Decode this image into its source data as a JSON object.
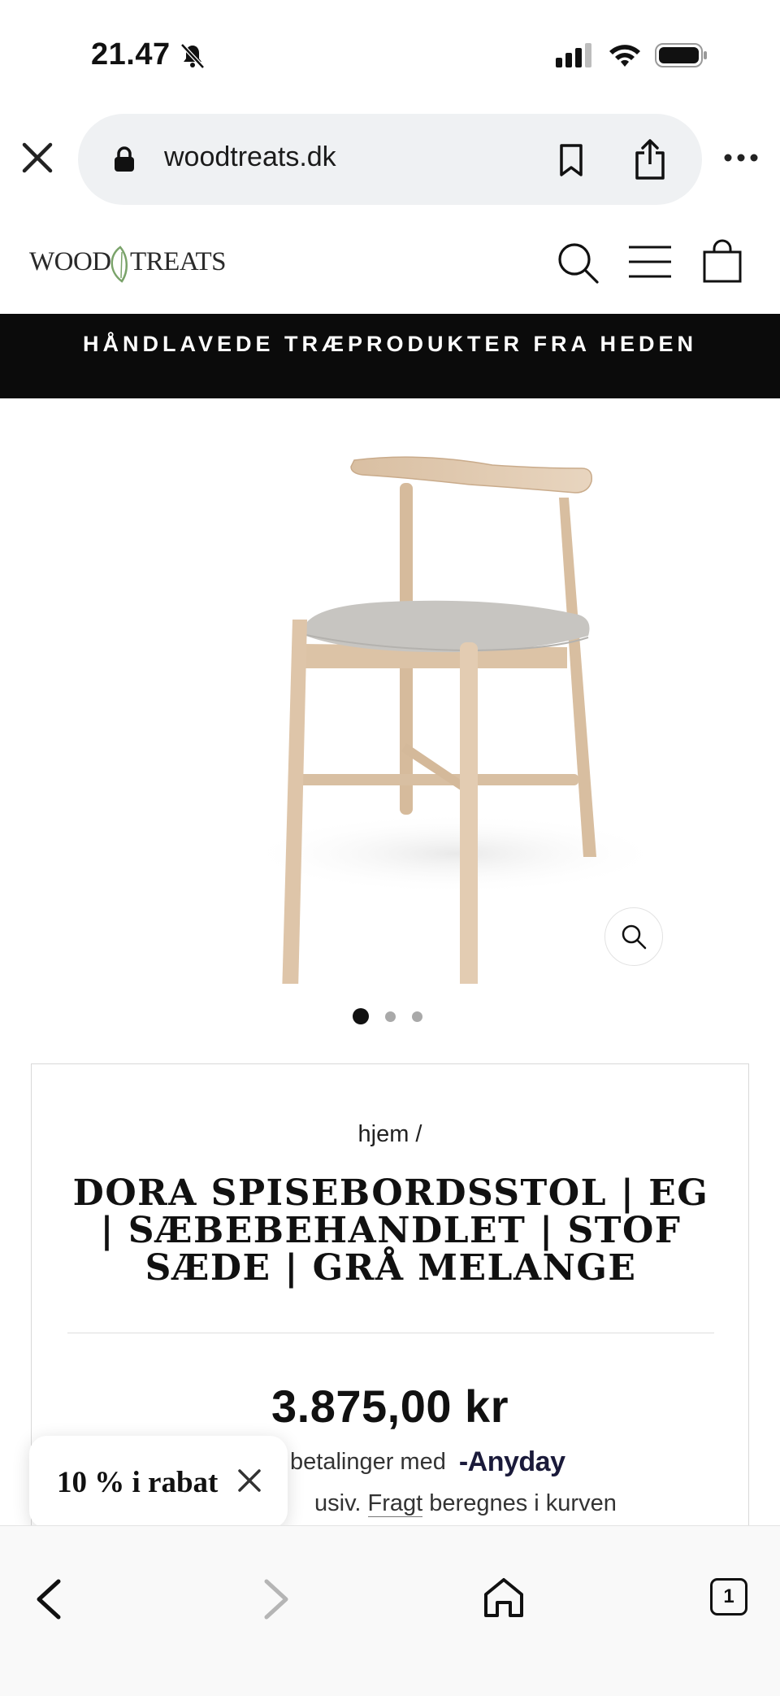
{
  "status_bar": {
    "time": "21.47"
  },
  "browser": {
    "url": "woodtreats.dk",
    "tab_count": "1"
  },
  "site": {
    "logo_text": "WOODTREATS",
    "announcement": "HÅNDLAVEDE TRÆPRODUKTER FRA HEDEN"
  },
  "gallery": {
    "slide_count": 3,
    "active_slide": 1
  },
  "product": {
    "breadcrumb": "hjem /",
    "title": "DORA SPISEBORDSSTOL | EG | SÆBEBEHANDLET | STOF SÆDE | GRÅ MELANGE",
    "price": "3.875,00 kr",
    "installments_text": "betalinger med",
    "installments_brand": "Anyday",
    "tax_text_prefix": "usiv.",
    "tax_link": "Fragt",
    "tax_text_suffix": "beregnes i kurven"
  },
  "popup": {
    "discount_label": "10 % i rabat"
  },
  "icons": {
    "status": [
      "bell-slash-icon",
      "cellular-signal-icon",
      "wifi-icon",
      "battery-icon"
    ],
    "browser": [
      "close-icon",
      "lock-icon",
      "bookmark-icon",
      "share-icon",
      "more-icon"
    ],
    "header": [
      "search-icon",
      "menu-icon",
      "cart-icon"
    ],
    "toolbar": [
      "back-icon",
      "forward-icon",
      "home-icon",
      "tabs-icon"
    ]
  },
  "colors": {
    "announcement_bg": "#0b0b0b",
    "address_bar_bg": "#eff1f3",
    "logo_leaf": "#7aa36a"
  }
}
